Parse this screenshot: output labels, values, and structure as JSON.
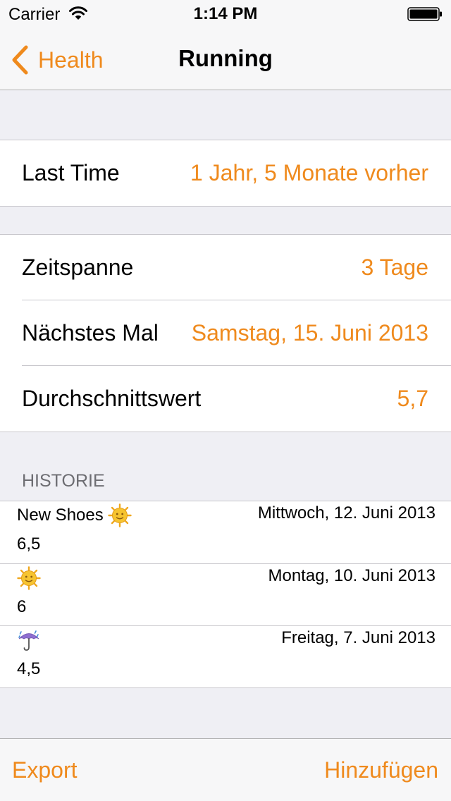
{
  "status_bar": {
    "carrier": "Carrier",
    "time": "1:14 PM"
  },
  "nav": {
    "back_label": "Health",
    "title": "Running"
  },
  "summary": {
    "last_time_label": "Last Time",
    "last_time_value": "1 Jahr, 5 Monate vorher"
  },
  "stats": [
    {
      "label": "Zeitspanne",
      "value": "3 Tage"
    },
    {
      "label": "Nächstes Mal",
      "value": "Samstag, 15. Juni 2013"
    },
    {
      "label": "Durchschnittswert",
      "value": "5,7"
    }
  ],
  "history": {
    "header": "HISTORIE",
    "entries": [
      {
        "note": "New Shoes",
        "weather_icon": "sun-icon",
        "date": "Mittwoch, 12. Juni 2013",
        "value": "6,5"
      },
      {
        "note": "",
        "weather_icon": "sun-icon",
        "date": "Montag, 10. Juni 2013",
        "value": "6"
      },
      {
        "note": "",
        "weather_icon": "umbrella-rain-icon",
        "date": "Freitag, 7. Juni 2013",
        "value": "4,5"
      }
    ]
  },
  "toolbar": {
    "export_label": "Export",
    "add_label": "Hinzufügen"
  },
  "colors": {
    "accent": "#ef8a1d",
    "background": "#efeff4",
    "separator": "#c8c7cc"
  }
}
